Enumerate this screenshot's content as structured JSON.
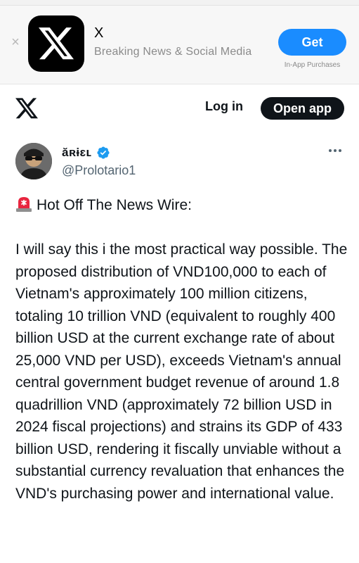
{
  "app_banner": {
    "app_name": "X",
    "subtitle": "Breaking News & Social Media",
    "get_label": "Get",
    "in_app_note": "In-App Purchases",
    "close_icon": "close-icon"
  },
  "nav": {
    "logo_icon": "x-logo-icon",
    "login_label": "Log in",
    "open_app_label": "Open app"
  },
  "tweet": {
    "display_name": "ăʀɨɛʟ",
    "handle": "@Prolotario1",
    "verified_color": "#1d9bf0",
    "headline_icon": "siren-icon",
    "headline": "Hot Off The News Wire:",
    "body": "I will say this i the most practical way possible. The proposed distribution of VND100,000 to each of Vietnam's approximately 100 million citizens, totaling 10 trillion VND (equivalent to roughly 400 billion USD at the current exchange rate of about 25,000 VND per USD), exceeds Vietnam's annual central government budget revenue of around 1.8 quadrillion VND (approximately 72 billion USD in 2024 fiscal projections) and strains its GDP of 433 billion USD, rendering it fiscally unviable without a substantial currency revaluation that enhances the VND's purchasing power and international value."
  },
  "colors": {
    "accent_blue": "#1a8cff",
    "dark": "#0f1419",
    "muted": "#536471"
  }
}
